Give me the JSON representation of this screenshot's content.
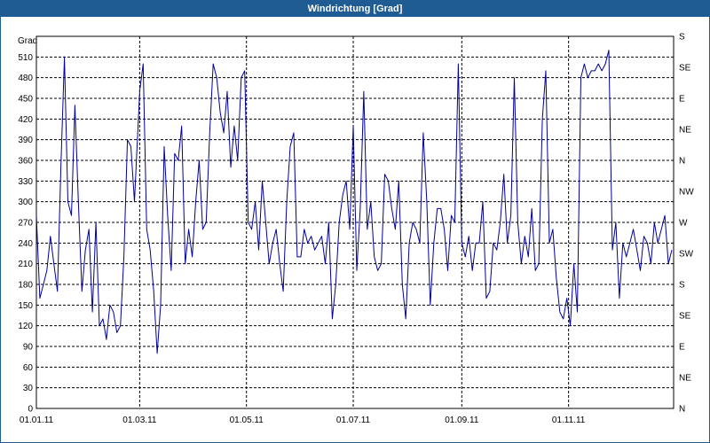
{
  "window": {
    "title": "Windrichtung [Grad]"
  },
  "chart_data": {
    "type": "line",
    "title": "Windrichtung [Grad]",
    "ylabel": "Grad",
    "ylim": [
      0,
      540
    ],
    "y_ticks": [
      0,
      30,
      60,
      90,
      120,
      150,
      180,
      210,
      240,
      270,
      300,
      330,
      360,
      390,
      420,
      450,
      480,
      510
    ],
    "y2_ticks": [
      {
        "value": 0,
        "label": "N"
      },
      {
        "value": 45,
        "label": "NE"
      },
      {
        "value": 90,
        "label": "E"
      },
      {
        "value": 135,
        "label": "SE"
      },
      {
        "value": 180,
        "label": "S"
      },
      {
        "value": 225,
        "label": "SW"
      },
      {
        "value": 270,
        "label": "W"
      },
      {
        "value": 315,
        "label": "NW"
      },
      {
        "value": 360,
        "label": "N"
      },
      {
        "value": 405,
        "label": "NE"
      },
      {
        "value": 450,
        "label": "E"
      },
      {
        "value": 495,
        "label": "SE"
      },
      {
        "value": 540,
        "label": "S"
      }
    ],
    "xlim": [
      "2011-01-01",
      "2011-12-31"
    ],
    "x_ticks": [
      {
        "date": "2011-01-01",
        "label": "01.01.11"
      },
      {
        "date": "2011-03-01",
        "label": "01.03.11"
      },
      {
        "date": "2011-05-01",
        "label": "01.05.11"
      },
      {
        "date": "2011-07-01",
        "label": "01.07.11"
      },
      {
        "date": "2011-09-01",
        "label": "01.09.11"
      },
      {
        "date": "2011-11-01",
        "label": "01.11.11"
      }
    ],
    "grid": true,
    "line_color": "#00009c",
    "series": [
      {
        "x": [
          "2011-01-01",
          "2011-01-03",
          "2011-01-05",
          "2011-01-07",
          "2011-01-09",
          "2011-01-11",
          "2011-01-13",
          "2011-01-15",
          "2011-01-17",
          "2011-01-19",
          "2011-01-21",
          "2011-01-23",
          "2011-01-25",
          "2011-01-27",
          "2011-01-29",
          "2011-01-31",
          "2011-02-02",
          "2011-02-04",
          "2011-02-06",
          "2011-02-08",
          "2011-02-10",
          "2011-02-12",
          "2011-02-14",
          "2011-02-16",
          "2011-02-18",
          "2011-02-20",
          "2011-02-22",
          "2011-02-24",
          "2011-02-26",
          "2011-03-01",
          "2011-03-03",
          "2011-03-05",
          "2011-03-07",
          "2011-03-09",
          "2011-03-11",
          "2011-03-13",
          "2011-03-15",
          "2011-03-17",
          "2011-03-19",
          "2011-03-21",
          "2011-03-23",
          "2011-03-25",
          "2011-03-27",
          "2011-03-29",
          "2011-03-31",
          "2011-04-02",
          "2011-04-04",
          "2011-04-06",
          "2011-04-08",
          "2011-04-10",
          "2011-04-12",
          "2011-04-14",
          "2011-04-16",
          "2011-04-18",
          "2011-04-20",
          "2011-04-22",
          "2011-04-24",
          "2011-04-26",
          "2011-04-28",
          "2011-04-30",
          "2011-05-02",
          "2011-05-04",
          "2011-05-06",
          "2011-05-08",
          "2011-05-10",
          "2011-05-12",
          "2011-05-14",
          "2011-05-16",
          "2011-05-18",
          "2011-05-20",
          "2011-05-22",
          "2011-05-24",
          "2011-05-26",
          "2011-05-28",
          "2011-05-30",
          "2011-06-01",
          "2011-06-03",
          "2011-06-05",
          "2011-06-07",
          "2011-06-09",
          "2011-06-11",
          "2011-06-13",
          "2011-06-15",
          "2011-06-17",
          "2011-06-19",
          "2011-06-21",
          "2011-06-23",
          "2011-06-25",
          "2011-06-27",
          "2011-06-29",
          "2011-07-01",
          "2011-07-03",
          "2011-07-05",
          "2011-07-07",
          "2011-07-09",
          "2011-07-11",
          "2011-07-13",
          "2011-07-15",
          "2011-07-17",
          "2011-07-19",
          "2011-07-21",
          "2011-07-23",
          "2011-07-25",
          "2011-07-27",
          "2011-07-29",
          "2011-07-31",
          "2011-08-02",
          "2011-08-04",
          "2011-08-06",
          "2011-08-08",
          "2011-08-10",
          "2011-08-12",
          "2011-08-14",
          "2011-08-16",
          "2011-08-18",
          "2011-08-20",
          "2011-08-22",
          "2011-08-24",
          "2011-08-26",
          "2011-08-28",
          "2011-08-30",
          "2011-09-01",
          "2011-09-03",
          "2011-09-05",
          "2011-09-07",
          "2011-09-09",
          "2011-09-11",
          "2011-09-13",
          "2011-09-15",
          "2011-09-17",
          "2011-09-19",
          "2011-09-21",
          "2011-09-23",
          "2011-09-25",
          "2011-09-27",
          "2011-09-29",
          "2011-10-01",
          "2011-10-03",
          "2011-10-05",
          "2011-10-07",
          "2011-10-09",
          "2011-10-11",
          "2011-10-13",
          "2011-10-15",
          "2011-10-17",
          "2011-10-19",
          "2011-10-21",
          "2011-10-23",
          "2011-10-25",
          "2011-10-27",
          "2011-10-29",
          "2011-10-31",
          "2011-11-02",
          "2011-11-04",
          "2011-11-06",
          "2011-11-08",
          "2011-11-10",
          "2011-11-12",
          "2011-11-14",
          "2011-11-16",
          "2011-11-18",
          "2011-11-20",
          "2011-11-22",
          "2011-11-24",
          "2011-11-26",
          "2011-11-28",
          "2011-11-30",
          "2011-12-02",
          "2011-12-04",
          "2011-12-06",
          "2011-12-08",
          "2011-12-10",
          "2011-12-12",
          "2011-12-14",
          "2011-12-16",
          "2011-12-18",
          "2011-12-20",
          "2011-12-22",
          "2011-12-24",
          "2011-12-26",
          "2011-12-28",
          "2011-12-30"
        ],
        "y": [
          280,
          160,
          180,
          200,
          250,
          210,
          170,
          350,
          510,
          300,
          280,
          440,
          300,
          170,
          230,
          260,
          140,
          270,
          120,
          130,
          100,
          150,
          140,
          110,
          120,
          220,
          390,
          380,
          300,
          460,
          500,
          260,
          230,
          170,
          80,
          150,
          380,
          280,
          200,
          370,
          360,
          410,
          210,
          260,
          220,
          300,
          360,
          260,
          270,
          400,
          500,
          480,
          430,
          400,
          460,
          350,
          410,
          360,
          480,
          490,
          270,
          260,
          300,
          230,
          330,
          270,
          210,
          240,
          260,
          210,
          170,
          300,
          380,
          400,
          220,
          220,
          260,
          240,
          250,
          230,
          240,
          250,
          210,
          270,
          130,
          180,
          270,
          310,
          330,
          260,
          410,
          200,
          290,
          460,
          260,
          300,
          220,
          200,
          210,
          340,
          330,
          290,
          260,
          330,
          180,
          130,
          240,
          270,
          260,
          240,
          400,
          300,
          150,
          240,
          290,
          290,
          260,
          200,
          280,
          270,
          500,
          240,
          220,
          250,
          200,
          240,
          240,
          300,
          160,
          170,
          240,
          230,
          270,
          340,
          240,
          280,
          480,
          270,
          210,
          250,
          220,
          290,
          200,
          210,
          420,
          490,
          240,
          260,
          190,
          140,
          130,
          160,
          120,
          210,
          140,
          480,
          500,
          480,
          490,
          490,
          500,
          490,
          500,
          520,
          230,
          270,
          160,
          240,
          220,
          240,
          260,
          230,
          200,
          250,
          240,
          210,
          270,
          240,
          260,
          280,
          210,
          230
        ]
      }
    ]
  }
}
